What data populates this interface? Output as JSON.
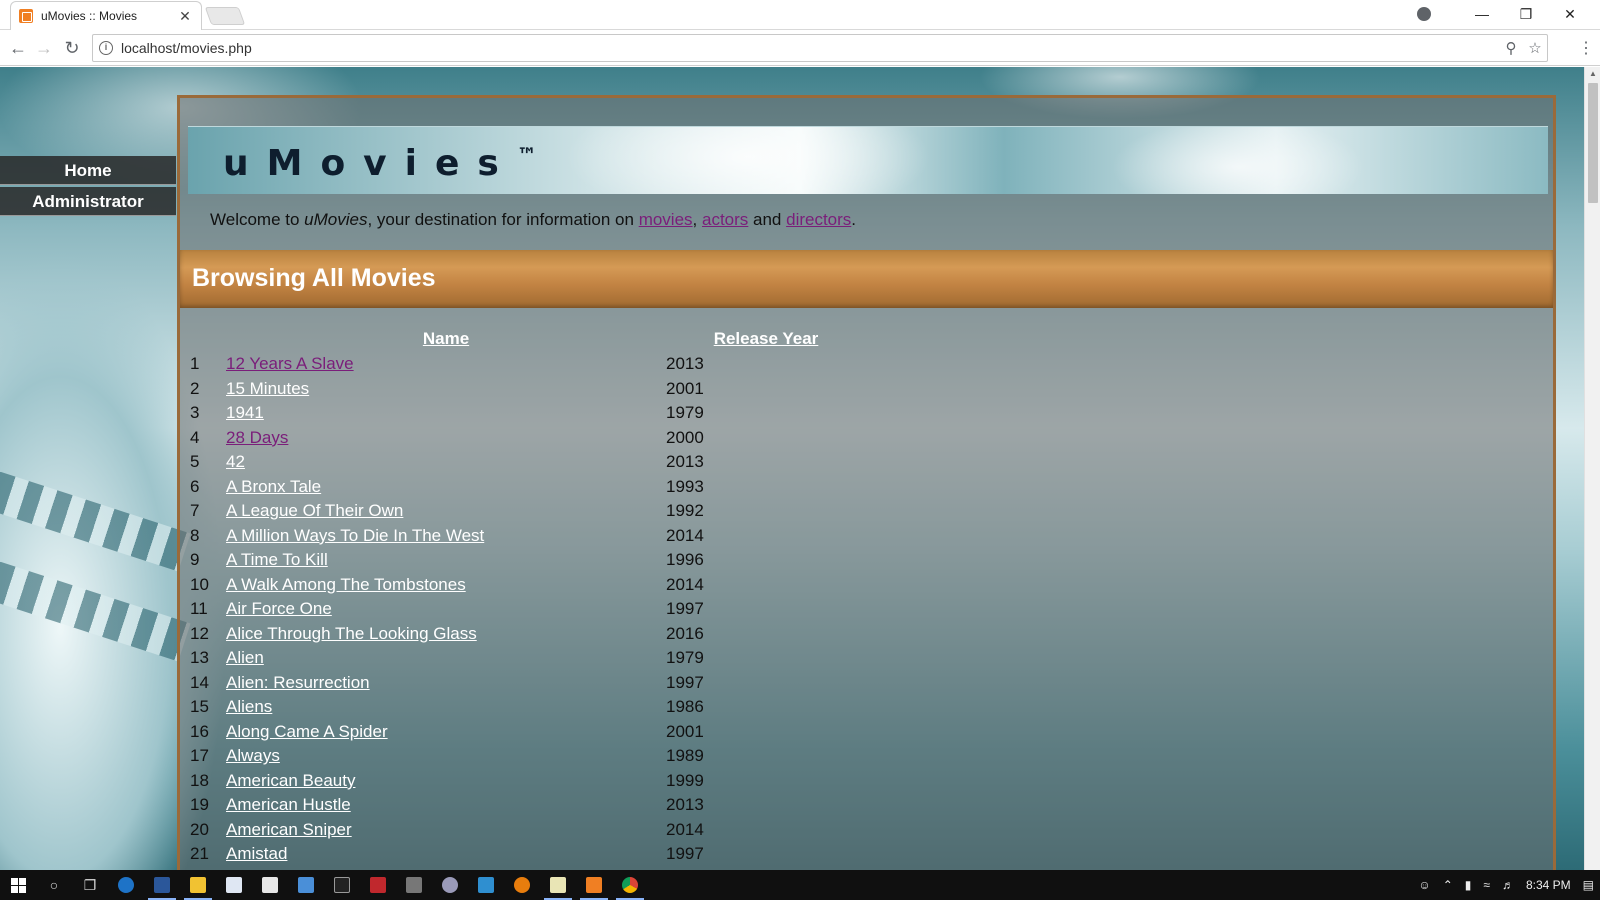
{
  "browser": {
    "tab_title": "uMovies :: Movies",
    "tab_close": "✕",
    "url": "localhost/movies.php"
  },
  "sidebar": {
    "items": [
      {
        "label": "Home"
      },
      {
        "label": "Administrator"
      }
    ]
  },
  "header": {
    "logo": "uMovies",
    "logo_mark": "™",
    "welcome_prefix": "Welcome to ",
    "welcome_brand": "uMovies",
    "welcome_mid": ", your destination for information on ",
    "link_movies": "movies",
    "sep1": ", ",
    "link_actors": "actors",
    "sep2": " and ",
    "link_directors": "directors",
    "welcome_end": "."
  },
  "section": {
    "title": "Browsing All Movies"
  },
  "table": {
    "columns": {
      "name": "Name",
      "year": "Release Year"
    },
    "rows": [
      {
        "n": "1",
        "name": "12 Years A Slave",
        "year": "2013",
        "visited": true
      },
      {
        "n": "2",
        "name": "15 Minutes",
        "year": "2001",
        "visited": false
      },
      {
        "n": "3",
        "name": "1941",
        "year": "1979",
        "visited": false
      },
      {
        "n": "4",
        "name": "28 Days",
        "year": "2000",
        "visited": true
      },
      {
        "n": "5",
        "name": "42",
        "year": "2013",
        "visited": false
      },
      {
        "n": "6",
        "name": "A Bronx Tale",
        "year": "1993",
        "visited": false
      },
      {
        "n": "7",
        "name": "A League Of Their Own",
        "year": "1992",
        "visited": false
      },
      {
        "n": "8",
        "name": "A Million Ways To Die In The West",
        "year": "2014",
        "visited": false
      },
      {
        "n": "9",
        "name": "A Time To Kill",
        "year": "1996",
        "visited": false
      },
      {
        "n": "10",
        "name": "A Walk Among The Tombstones",
        "year": "2014",
        "visited": false
      },
      {
        "n": "11",
        "name": "Air Force One",
        "year": "1997",
        "visited": false
      },
      {
        "n": "12",
        "name": "Alice Through The Looking Glass",
        "year": "2016",
        "visited": false
      },
      {
        "n": "13",
        "name": "Alien",
        "year": "1979",
        "visited": false
      },
      {
        "n": "14",
        "name": "Alien: Resurrection",
        "year": "1997",
        "visited": false
      },
      {
        "n": "15",
        "name": "Aliens",
        "year": "1986",
        "visited": false
      },
      {
        "n": "16",
        "name": "Along Came A Spider",
        "year": "2001",
        "visited": false
      },
      {
        "n": "17",
        "name": "Always",
        "year": "1989",
        "visited": false
      },
      {
        "n": "18",
        "name": "American Beauty",
        "year": "1999",
        "visited": false
      },
      {
        "n": "19",
        "name": "American Hustle",
        "year": "2013",
        "visited": false
      },
      {
        "n": "20",
        "name": "American Sniper",
        "year": "2014",
        "visited": false
      },
      {
        "n": "21",
        "name": "Amistad",
        "year": "1997",
        "visited": false
      }
    ]
  },
  "taskbar": {
    "clock": "8:34 PM"
  },
  "colors": {
    "visited_link": "#7a1e7a",
    "section_bar": "#c28343",
    "frame_border": "#9a6a3a"
  }
}
